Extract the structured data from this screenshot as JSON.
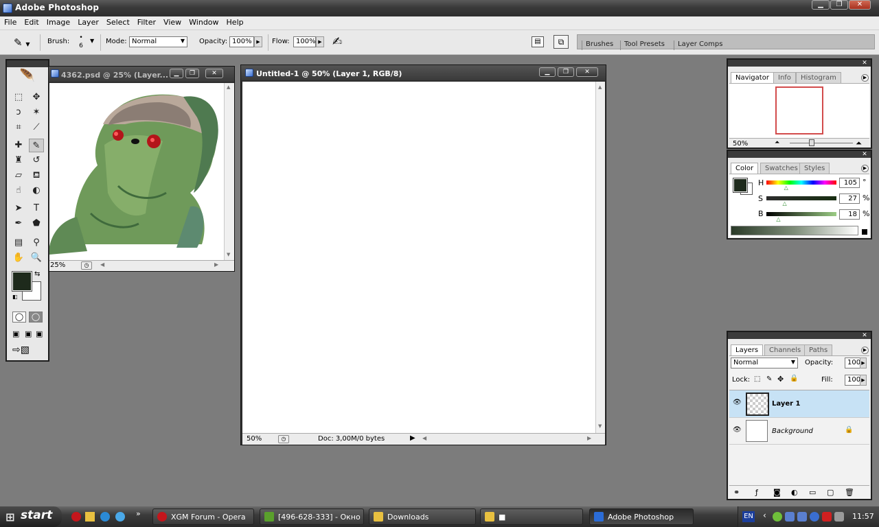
{
  "app": {
    "title": "Adobe Photoshop"
  },
  "menu": [
    "File",
    "Edit",
    "Image",
    "Layer",
    "Select",
    "Filter",
    "View",
    "Window",
    "Help"
  ],
  "options": {
    "brush_label": "Brush:",
    "brush_size": "6",
    "mode_label": "Mode:",
    "mode_value": "Normal",
    "opacity_label": "Opacity:",
    "opacity_value": "100%",
    "flow_label": "Flow:",
    "flow_value": "100%",
    "well_tabs": [
      "Brushes",
      "Tool Presets",
      "Layer Comps"
    ]
  },
  "toolbox": {
    "tools": [
      {
        "name": "marquee-tool-icon",
        "glyph": "⬚"
      },
      {
        "name": "move-tool-icon",
        "glyph": "✥"
      },
      {
        "name": "lasso-tool-icon",
        "glyph": "ↄ"
      },
      {
        "name": "magic-wand-tool-icon",
        "glyph": "✶"
      },
      {
        "name": "crop-tool-icon",
        "glyph": "⌗"
      },
      {
        "name": "slice-tool-icon",
        "glyph": "⟋"
      },
      {
        "name": "healing-brush-tool-icon",
        "glyph": "✚"
      },
      {
        "name": "brush-tool-icon",
        "glyph": "✎"
      },
      {
        "name": "clone-stamp-tool-icon",
        "glyph": "♜"
      },
      {
        "name": "history-brush-tool-icon",
        "glyph": "↺"
      },
      {
        "name": "eraser-tool-icon",
        "glyph": "▱"
      },
      {
        "name": "paint-bucket-tool-icon",
        "glyph": "⛾"
      },
      {
        "name": "smudge-tool-icon",
        "glyph": "☝"
      },
      {
        "name": "dodge-tool-icon",
        "glyph": "◐"
      },
      {
        "name": "path-selection-tool-icon",
        "glyph": "➤"
      },
      {
        "name": "type-tool-icon",
        "glyph": "T"
      },
      {
        "name": "pen-tool-icon",
        "glyph": "✒"
      },
      {
        "name": "shape-tool-icon",
        "glyph": "⬟"
      },
      {
        "name": "notes-tool-icon",
        "glyph": "▤"
      },
      {
        "name": "eyedropper-tool-icon",
        "glyph": "⚲"
      },
      {
        "name": "hand-tool-icon",
        "glyph": "✋"
      },
      {
        "name": "zoom-tool-icon",
        "glyph": "🔍"
      }
    ],
    "fg_color": "#1e2a1c",
    "bg_color": "#ffffff"
  },
  "doc1": {
    "title": "4362.psd @ 25% (Layer...",
    "zoom": "25%"
  },
  "doc2": {
    "title": "Untitled-1 @ 50% (Layer 1, RGB/8)",
    "zoom": "50%",
    "doc_info": "Doc: 3,00M/0 bytes"
  },
  "navigator": {
    "tabs": [
      "Navigator",
      "Info",
      "Histogram"
    ],
    "zoom": "50%"
  },
  "color": {
    "tabs": [
      "Color",
      "Swatches",
      "Styles"
    ],
    "h_label": "H",
    "h_value": "105",
    "h_unit": "°",
    "s_label": "S",
    "s_value": "27",
    "s_unit": "%",
    "b_label": "B",
    "b_value": "18",
    "b_unit": "%",
    "h_level": 0.29,
    "s_level": 0.27,
    "b_level": 0.18,
    "fg_color": "#1e2a1c"
  },
  "layers": {
    "tabs": [
      "Layers",
      "Channels",
      "Paths"
    ],
    "blend_mode": "Normal",
    "opacity_label": "Opacity:",
    "opacity_value": "100%",
    "lock_label": "Lock:",
    "fill_label": "Fill:",
    "fill_value": "100%",
    "items": [
      {
        "name": "Layer 1",
        "selected": true
      },
      {
        "name": "Background",
        "selected": false
      }
    ]
  },
  "taskbar": {
    "start_label": "start",
    "tasks": [
      {
        "label": "XGM Forum - Opera",
        "color": "#c4161c"
      },
      {
        "label": "[496-628-333] - Окно ...",
        "color": "#5aa02c"
      },
      {
        "label": "Downloads",
        "color": "#e8c040"
      },
      {
        "label": "■",
        "color": "#e8c040"
      },
      {
        "label": "Adobe Photoshop",
        "color": "#2b6cd6"
      }
    ],
    "lang": "EN",
    "time": "11:57"
  }
}
